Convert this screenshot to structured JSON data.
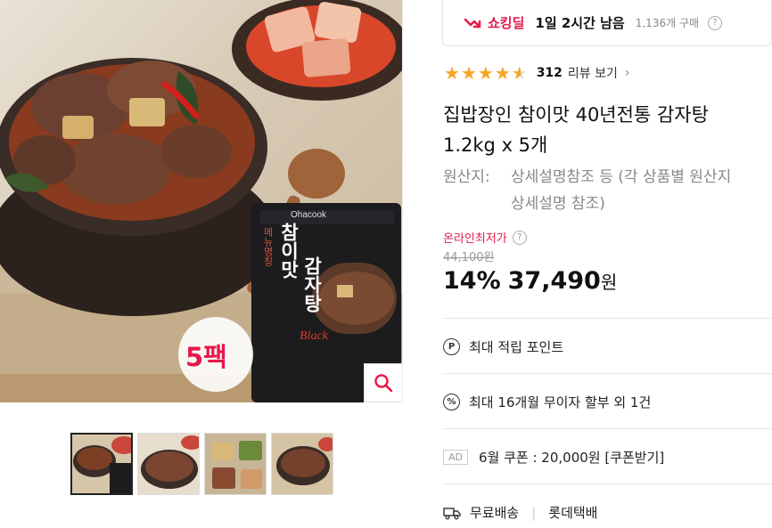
{
  "deal": {
    "name": "쇼킹딜",
    "time_left": "1일 2시간 남음",
    "purchase_count": "1,136개 구매",
    "help": "?"
  },
  "rating": {
    "stars": 4.5,
    "review_count": "312",
    "review_link": "리뷰 보기"
  },
  "product": {
    "title_line1": "집밥장인 참이맛 40년전통 감자탕",
    "title_line2": "1.2kg x 5개",
    "origin_label": "원산지:",
    "origin_line1": "상세설명참조 등 (각 상품별 원산지",
    "origin_line2": "상세설명 참조)"
  },
  "image": {
    "pack_badge": "5팩",
    "brand": "Ohacook",
    "package_title_a": "참이맛",
    "package_title_b": "감자탕",
    "package_sub": "Black",
    "package_side": "메뉴명칭"
  },
  "price": {
    "lowest_label": "온라인최저가",
    "original": "44,100원",
    "discount": "14%",
    "current": "37,490",
    "unit": "원"
  },
  "benefits": {
    "points_icon": "P",
    "points": "최대 적립 포인트",
    "installment_icon": "%",
    "installment": "최대 16개월 무이자 할부 외 1건",
    "ad_tag": "AD",
    "coupon": "6월 쿠폰 : 20,000원 [쿠폰받기]",
    "shipping": "무료배송",
    "carrier": "롯데택배"
  },
  "colors": {
    "accent": "#e8174a",
    "star": "#f5a623"
  }
}
